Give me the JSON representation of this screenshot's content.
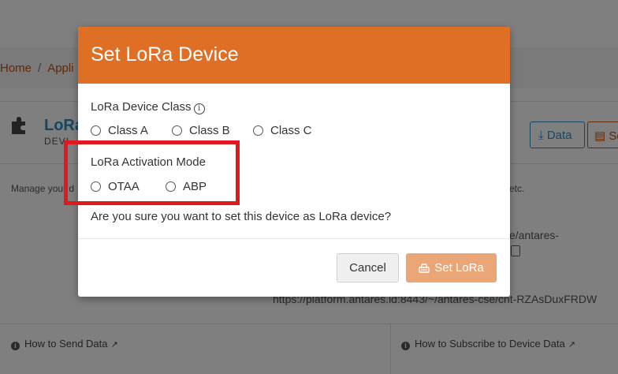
{
  "background": {
    "breadcrumb": [
      "Home",
      "Appli"
    ],
    "title": "LoRa",
    "subtitle": "DEVI",
    "data_button": "Data",
    "set_button": "Se",
    "description_left": "Manage your d",
    "description_right": "etc.",
    "url_line1": "e/antares-",
    "url_line2": "https://platform.antares.id:8443/~/antares-cse/cnt-RZAsDuxFRDW",
    "footer_left": "How to Send Data",
    "footer_right": "How to Subscribe to Device Data"
  },
  "modal": {
    "title": "Set LoRa Device",
    "device_class": {
      "label": "LoRa Device Class",
      "options": [
        "Class A",
        "Class B",
        "Class C"
      ]
    },
    "activation_mode": {
      "label": "LoRa Activation Mode",
      "options": [
        "OTAA",
        "ABP"
      ]
    },
    "confirm_text": "Are you sure you want to set this device as LoRa device?",
    "cancel_label": "Cancel",
    "submit_label": "Set LoRa"
  },
  "colors": {
    "header": "#de6f24",
    "submit": "#eaa677",
    "highlight": "#e0191f",
    "link": "#2a8fc4"
  },
  "icons": [
    "info-icon",
    "puzzle-icon",
    "download-icon",
    "lora-icon",
    "copy-icon",
    "external-link-icon"
  ]
}
